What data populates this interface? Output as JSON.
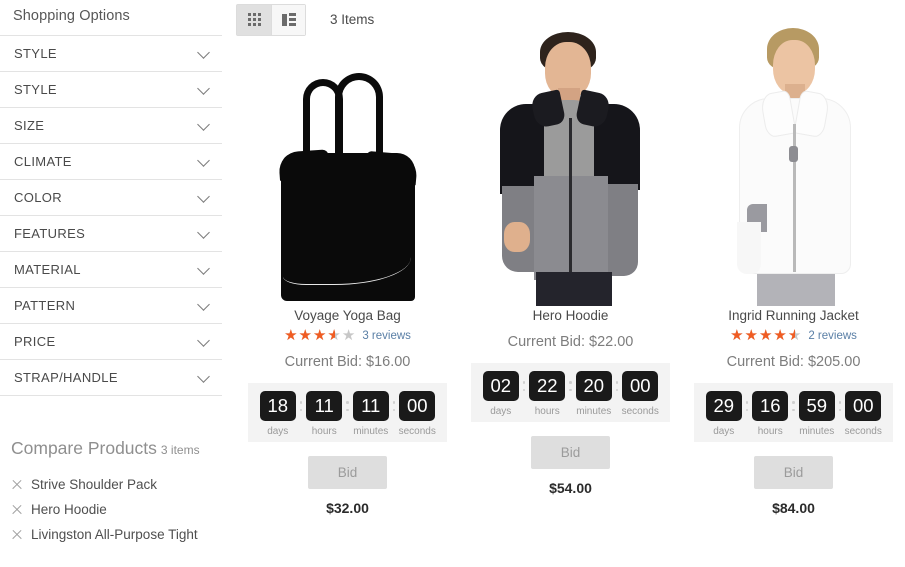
{
  "sidebar": {
    "title": "Shopping Options",
    "filters": [
      {
        "label": "STYLE"
      },
      {
        "label": "STYLE"
      },
      {
        "label": "SIZE"
      },
      {
        "label": "CLIMATE"
      },
      {
        "label": "COLOR"
      },
      {
        "label": "FEATURES"
      },
      {
        "label": "MATERIAL"
      },
      {
        "label": "PATTERN"
      },
      {
        "label": "PRICE"
      },
      {
        "label": "STRAP/HANDLE"
      }
    ],
    "compare": {
      "title": "Compare Products",
      "count": "3 items",
      "items": [
        {
          "name": "Strive Shoulder Pack",
          "remove_icon": "close-x-icon"
        },
        {
          "name": "Hero Hoodie",
          "remove_icon": "close-x-icon"
        },
        {
          "name": "Livingston All-Purpose Tight",
          "remove_icon": "close-x-icon"
        }
      ]
    }
  },
  "toolbar": {
    "grid_mode_icon": "grid-view-icon",
    "list_mode_icon": "list-view-icon",
    "active_mode": "grid",
    "item_count": "3 Items"
  },
  "products": [
    {
      "name": "Voyage Yoga Bag",
      "image": "black-tote-bag",
      "rating_percent": 70,
      "reviews": "3 reviews",
      "has_rating": true,
      "current_bid": "Current Bid: $16.00",
      "timer": [
        {
          "value": "18",
          "label": "days"
        },
        {
          "value": "11",
          "label": "hours"
        },
        {
          "value": "11",
          "label": "minutes"
        },
        {
          "value": "00",
          "label": "seconds"
        }
      ],
      "bid_label": "Bid",
      "price": "$32.00"
    },
    {
      "name": "Hero Hoodie",
      "image": "male-model-hoodie",
      "rating_percent": 0,
      "reviews": "",
      "has_rating": false,
      "current_bid": "Current Bid: $22.00",
      "timer": [
        {
          "value": "02",
          "label": "days"
        },
        {
          "value": "22",
          "label": "hours"
        },
        {
          "value": "20",
          "label": "minutes"
        },
        {
          "value": "00",
          "label": "seconds"
        }
      ],
      "bid_label": "Bid",
      "price": "$54.00"
    },
    {
      "name": "Ingrid Running Jacket",
      "image": "female-model-white-jacket",
      "rating_percent": 90,
      "reviews": "2 reviews",
      "has_rating": true,
      "current_bid": "Current Bid: $205.00",
      "timer": [
        {
          "value": "29",
          "label": "days"
        },
        {
          "value": "16",
          "label": "hours"
        },
        {
          "value": "59",
          "label": "minutes"
        },
        {
          "value": "00",
          "label": "seconds"
        }
      ],
      "bid_label": "Bid",
      "price": "$84.00"
    }
  ],
  "colors": {
    "star_filled": "#f05c22",
    "star_empty": "#c7c7c7",
    "review_link": "#5a7fa6",
    "timer_box": "#1a1a1a",
    "bid_button": "#dedede"
  }
}
